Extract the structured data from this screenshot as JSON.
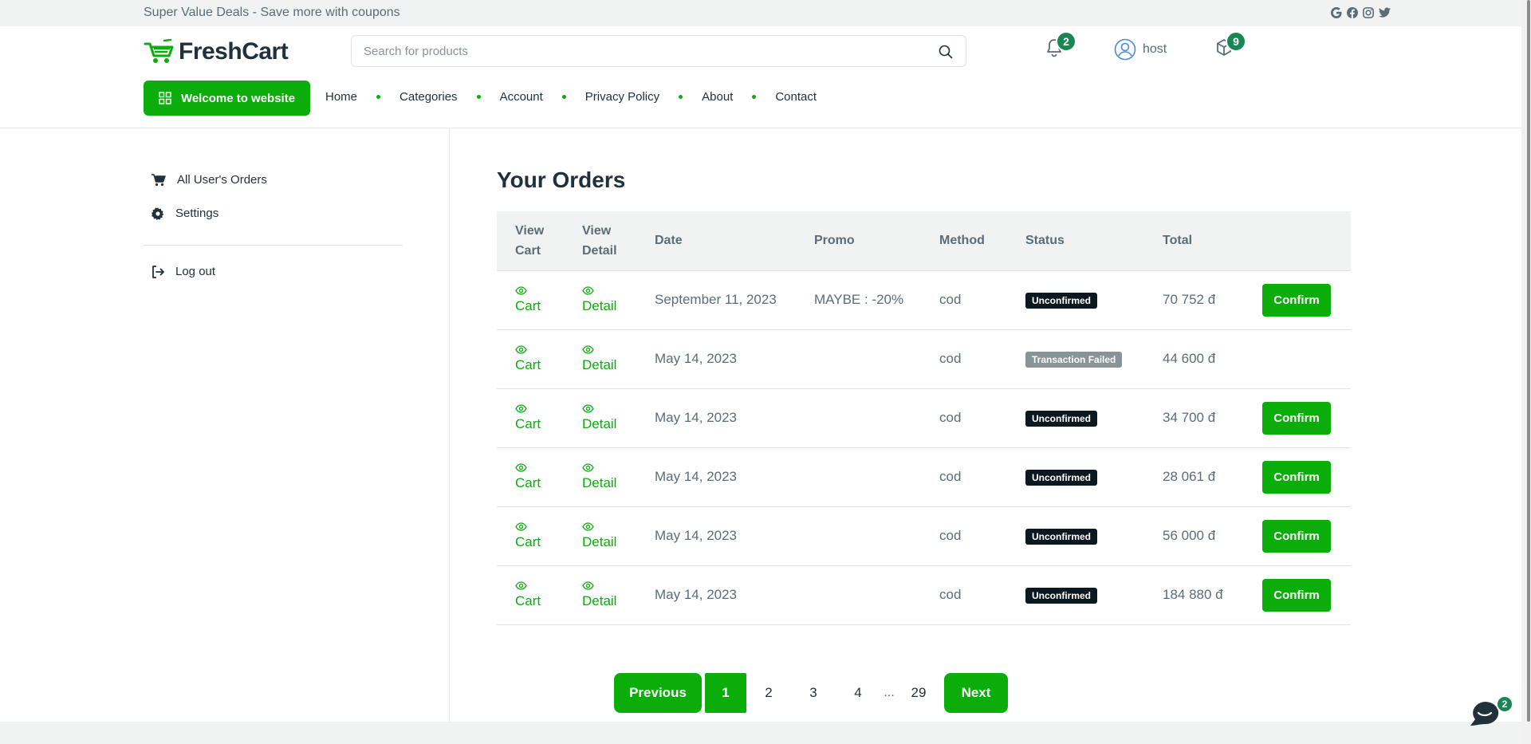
{
  "topbar": {
    "text": "Super Value Deals - Save more with coupons",
    "social": [
      "google-icon",
      "facebook-icon",
      "instagram-icon",
      "twitter-icon"
    ]
  },
  "header": {
    "logo_text": "FreshCart",
    "search_placeholder": "Search for products",
    "notifications_count": "2",
    "user_name": "host",
    "cart_count": "9"
  },
  "nav": {
    "welcome_label": "Welcome to website",
    "items": [
      "Home",
      "Categories",
      "Account",
      "Privacy Policy",
      "About",
      "Contact"
    ]
  },
  "sidebar": {
    "orders_label": "All User's Orders",
    "settings_label": "Settings",
    "logout_label": "Log out"
  },
  "main": {
    "title": "Your Orders",
    "columns": [
      "View Cart",
      "View Detail",
      "Date",
      "Promo",
      "Method",
      "Status",
      "Total"
    ],
    "cart_label": "Cart",
    "detail_label": "Detail",
    "confirm_label": "Confirm",
    "orders": [
      {
        "date": "September 11, 2023",
        "promo": "MAYBE : -20%",
        "method": "cod",
        "status": "Unconfirmed",
        "total": "70 752 đ"
      },
      {
        "date": "May 14, 2023",
        "promo": "",
        "method": "cod",
        "status": "Transaction Failed",
        "total": "44 600 đ"
      },
      {
        "date": "May 14, 2023",
        "promo": "",
        "method": "cod",
        "status": "Unconfirmed",
        "total": "34 700 đ"
      },
      {
        "date": "May 14, 2023",
        "promo": "",
        "method": "cod",
        "status": "Unconfirmed",
        "total": "28 061 đ"
      },
      {
        "date": "May 14, 2023",
        "promo": "",
        "method": "cod",
        "status": "Unconfirmed",
        "total": "56 000 đ"
      },
      {
        "date": "May 14, 2023",
        "promo": "",
        "method": "cod",
        "status": "Unconfirmed",
        "total": "184 880 đ"
      }
    ]
  },
  "pagination": {
    "previous": "Previous",
    "current": "1",
    "pages": [
      "2",
      "3",
      "4"
    ],
    "ellipsis": "...",
    "last": "29",
    "next": "Next"
  },
  "chat": {
    "badge": "2"
  },
  "colors": {
    "accent": "#0aad0a",
    "badge": "#198754",
    "dark_badge": "#0b1820"
  }
}
